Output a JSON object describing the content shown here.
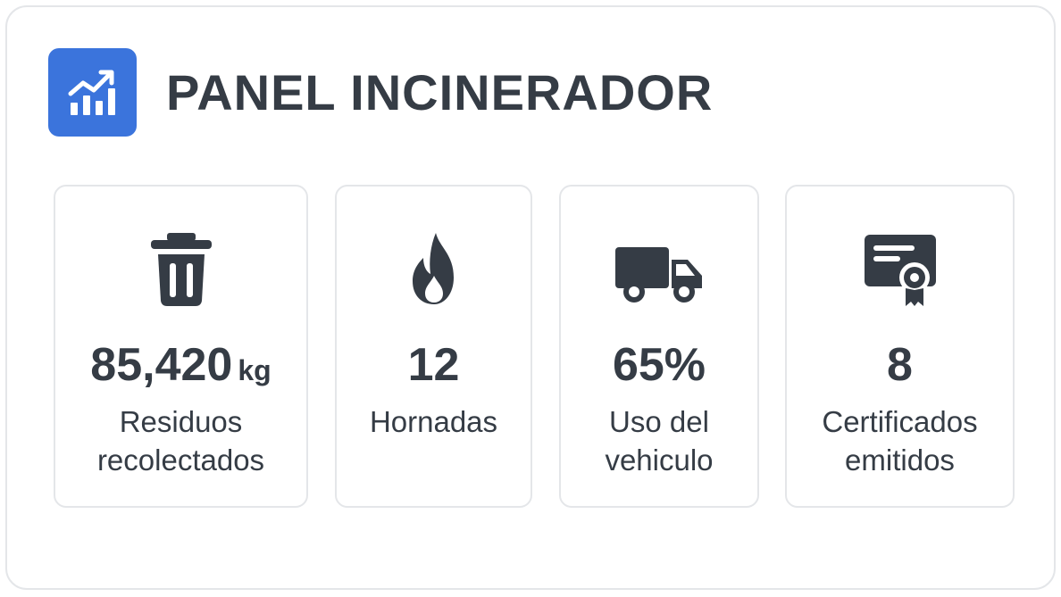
{
  "header": {
    "title": "PANEL INCINERADOR",
    "logo_icon": "chart-growth-icon",
    "logo_color": "#3b74dc"
  },
  "text_color": "#353c45",
  "cards": [
    {
      "icon": "trash-icon",
      "value": "85,420",
      "unit": "kg",
      "label_line1": "Residuos",
      "label_line2": "recolectados"
    },
    {
      "icon": "fire-icon",
      "value": "12",
      "unit": "",
      "label_line1": "Hornadas",
      "label_line2": ""
    },
    {
      "icon": "truck-icon",
      "value": "65%",
      "unit": "",
      "label_line1": "Uso del",
      "label_line2": "vehiculo"
    },
    {
      "icon": "certificate-icon",
      "value": "8",
      "unit": "",
      "label_line1": "Certificados",
      "label_line2": "emitidos"
    }
  ]
}
